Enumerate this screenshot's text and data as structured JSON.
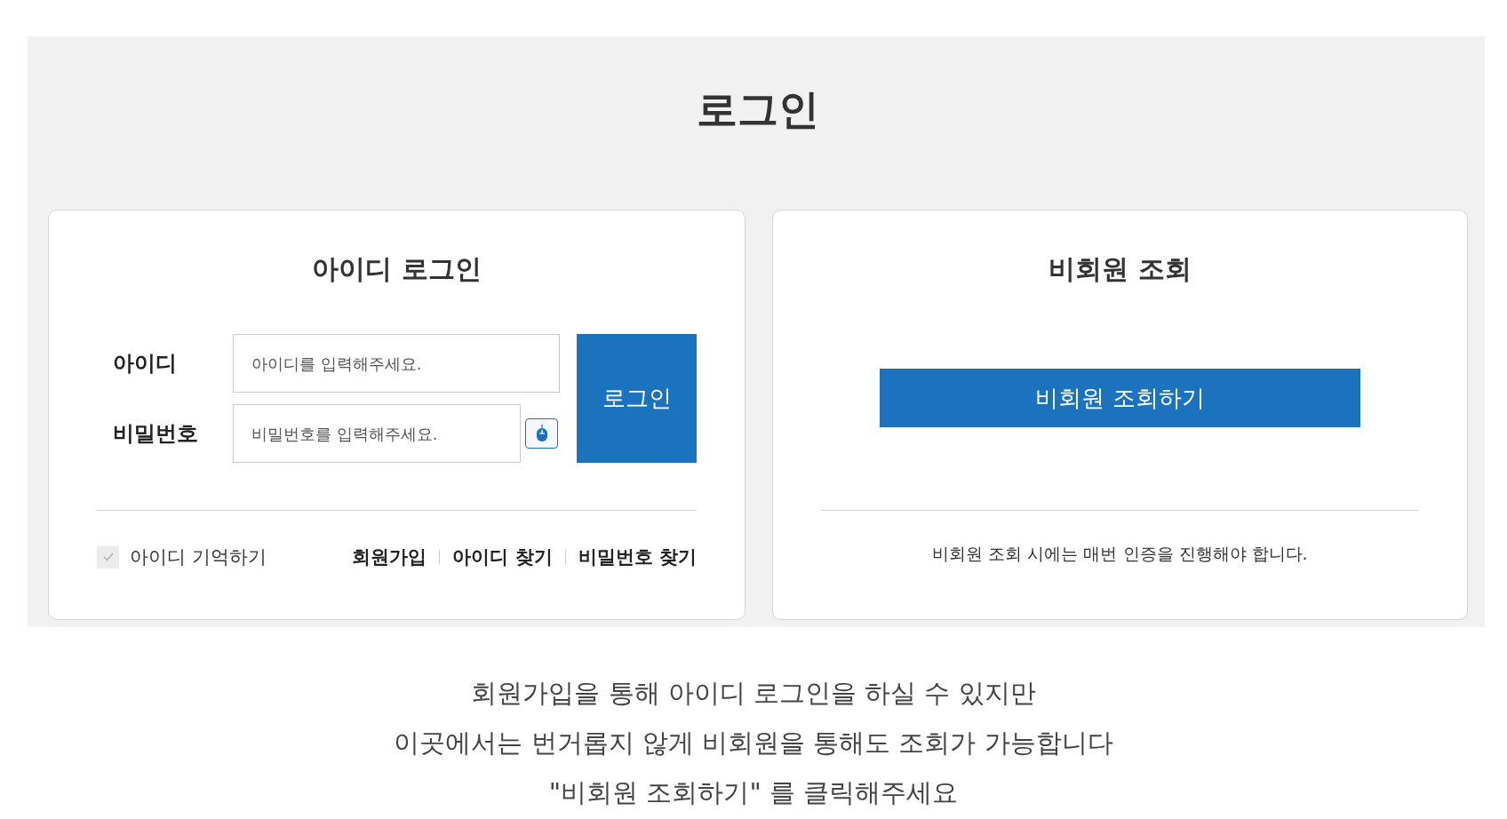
{
  "page_title": "로그인",
  "member_login": {
    "title": "아이디 로그인",
    "fields": [
      {
        "label": "아이디",
        "placeholder": "아이디를 입력해주세요.",
        "kind": "text"
      },
      {
        "label": "비밀번호",
        "placeholder": "비밀번호를 입력해주세요.",
        "kind": "password"
      }
    ],
    "login_button": "로그인",
    "remember": {
      "label": "아이디 기억하기",
      "checked": false
    },
    "links": [
      "회원가입",
      "아이디 찾기",
      "비밀번호 찾기"
    ]
  },
  "guest_lookup": {
    "title": "비회원 조회",
    "button": "비회원 조회하기",
    "note": "비회원 조회 시에는 매번 인증을 진행해야 합니다."
  },
  "info_lines": [
    "회원가입을 통해 아이디 로그인을 하실 수 있지만",
    "이곳에서는 번거롭지 않게 비회원을 통해도 조회가 가능합니다",
    "\"비회원 조회하기\" 를 클릭해주세요"
  ]
}
